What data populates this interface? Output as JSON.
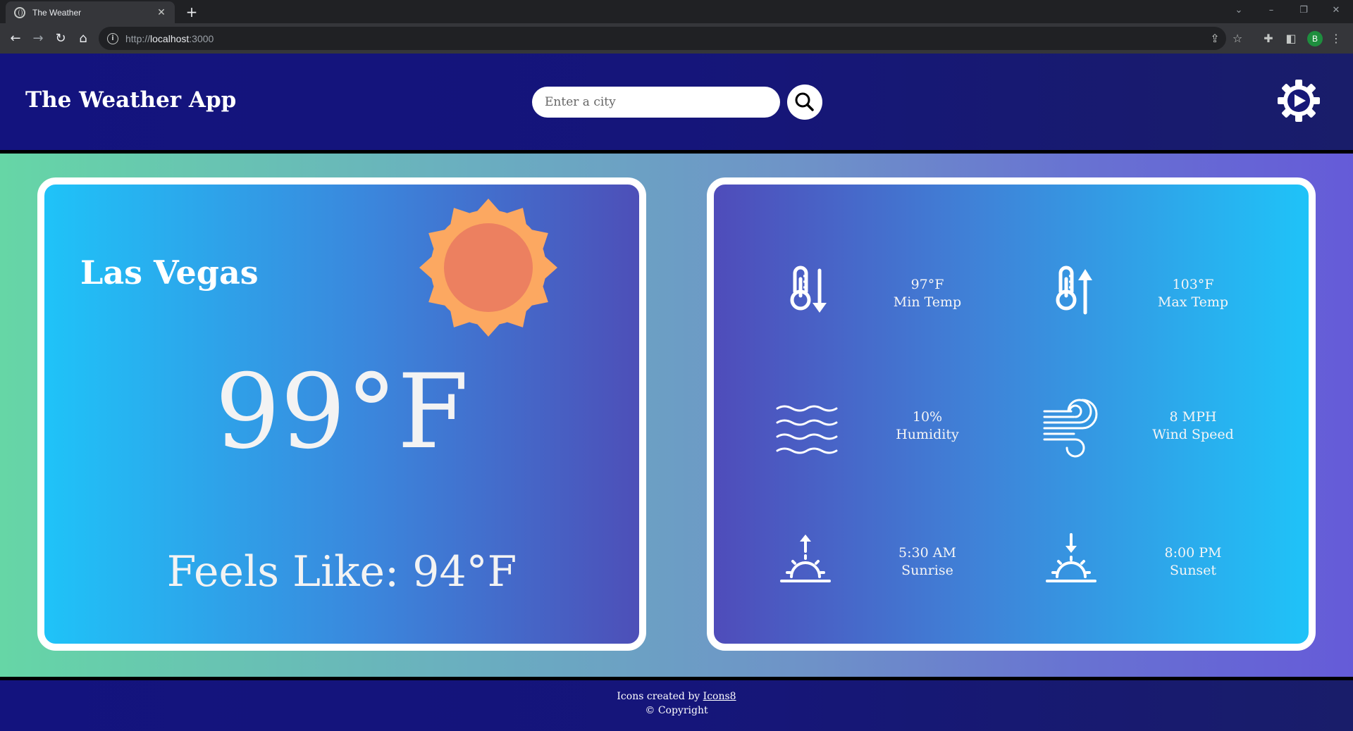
{
  "browser": {
    "tab_title": "The Weather",
    "url_protocol": "http://",
    "url_host": "localhost",
    "url_port": ":3000",
    "profile_initial": "B"
  },
  "header": {
    "title": "The Weather App",
    "search_placeholder": "Enter a city"
  },
  "current": {
    "city": "Las Vegas",
    "temperature": "99°F",
    "feels_like": "Feels Like: 94°F",
    "condition_icon": "sun-icon"
  },
  "stats": [
    {
      "icon": "min-temp-icon",
      "value": "97°F",
      "label": "Min Temp"
    },
    {
      "icon": "max-temp-icon",
      "value": "103°F",
      "label": "Max Temp"
    },
    {
      "icon": "humidity-icon",
      "value": "10%",
      "label": "Humidity"
    },
    {
      "icon": "wind-icon",
      "value": "8 MPH",
      "label": "Wind Speed"
    },
    {
      "icon": "sunrise-icon",
      "value": "5:30 AM",
      "label": "Sunrise"
    },
    {
      "icon": "sunset-icon",
      "value": "8:00 PM",
      "label": "Sunset"
    }
  ],
  "footer": {
    "credit_prefix": "Icons created by",
    "credit_link": "Icons8",
    "copyright": "© Copyright"
  },
  "colors": {
    "header_bg": "#15157a",
    "sun_outer": "#fca861",
    "sun_inner": "#ec8060"
  }
}
